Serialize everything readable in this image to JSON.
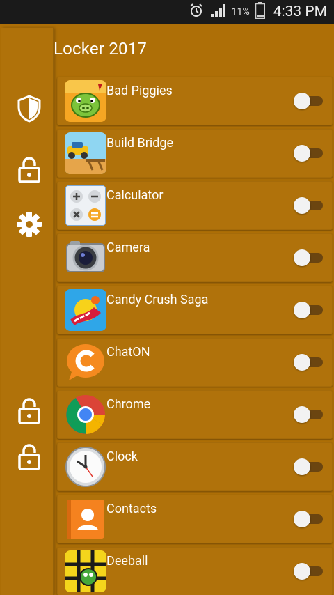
{
  "status_bar": {
    "battery_percent": "11%",
    "time": "4:33 PM",
    "icons": [
      "alarm-icon",
      "signal-icon",
      "battery-icon"
    ]
  },
  "header": {
    "title": "Locker 2017"
  },
  "rail": {
    "items": [
      {
        "icon": "shield-icon"
      },
      {
        "icon": "lock-icon"
      },
      {
        "icon": "gear-icon"
      },
      {
        "icon": "lock-icon"
      },
      {
        "icon": "lock-icon"
      }
    ]
  },
  "apps": [
    {
      "name": "Bad Piggies",
      "locked": false,
      "icon": "bad-piggies-icon"
    },
    {
      "name": "Build Bridge",
      "locked": false,
      "icon": "build-bridge-icon"
    },
    {
      "name": "Calculator",
      "locked": false,
      "icon": "calculator-icon"
    },
    {
      "name": "Camera",
      "locked": false,
      "icon": "camera-icon"
    },
    {
      "name": "Candy Crush Saga",
      "locked": false,
      "icon": "candy-crush-icon"
    },
    {
      "name": "ChatON",
      "locked": false,
      "icon": "chaton-icon"
    },
    {
      "name": "Chrome",
      "locked": false,
      "icon": "chrome-icon"
    },
    {
      "name": "Clock",
      "locked": false,
      "icon": "clock-icon"
    },
    {
      "name": "Contacts",
      "locked": false,
      "icon": "contacts-icon"
    },
    {
      "name": "Deeball",
      "locked": false,
      "icon": "deeball-icon"
    }
  ],
  "colors": {
    "background": "#ae6f07",
    "row": "#b0720b",
    "status_bar": "#1a1a1a",
    "text": "#ffffff",
    "toggle_track": "#6b4510",
    "toggle_thumb": "#f2f2f2"
  }
}
